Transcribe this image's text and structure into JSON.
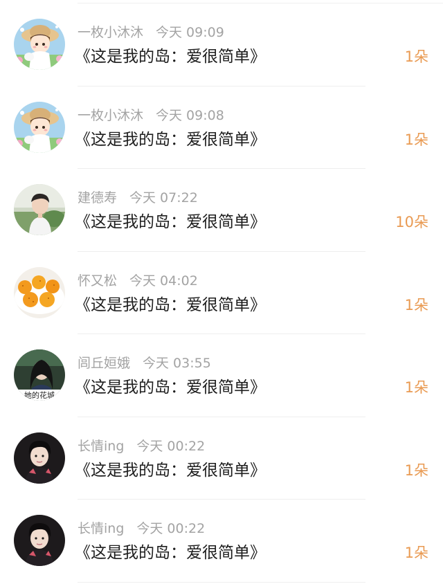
{
  "gift_records": [
    {
      "name": "一枚小沐沐",
      "time": "今天 09:09",
      "content": "《这是我的岛：爱很简单》",
      "count": "1朵",
      "avatar": "girl-straw-hat"
    },
    {
      "name": "一枚小沐沐",
      "time": "今天 09:08",
      "content": "《这是我的岛：爱很简单》",
      "count": "1朵",
      "avatar": "girl-straw-hat"
    },
    {
      "name": "建德寿",
      "time": "今天 07:22",
      "content": "《这是我的岛：爱很简单》",
      "count": "10朵",
      "avatar": "man-outdoor"
    },
    {
      "name": "怀又松",
      "time": "今天 04:02",
      "content": "《这是我的岛：爱很简单》",
      "count": "1朵",
      "avatar": "orange-fruits"
    },
    {
      "name": "闾丘姮娥",
      "time": "今天 03:55",
      "content": "《这是我的岛：爱很简单》",
      "count": "1朵",
      "avatar": "woman-dark-hair",
      "avatar_caption": "她的花城"
    },
    {
      "name": "长情ing",
      "time": "今天 00:22",
      "content": "《这是我的岛：爱很简单》",
      "count": "1朵",
      "avatar": "boy-dark-hair"
    },
    {
      "name": "长情ing",
      "time": "今天 00:22",
      "content": "《这是我的岛：爱很简单》",
      "count": "1朵",
      "avatar": "boy-dark-hair"
    }
  ],
  "colors": {
    "meta_text": "#a3a3a3",
    "content_text": "#1e1e1e",
    "count_accent": "#e99a52",
    "divider": "#eeeeee"
  }
}
